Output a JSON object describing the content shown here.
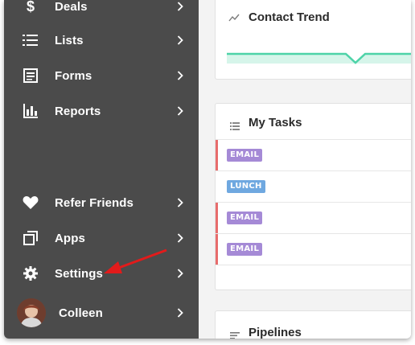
{
  "sidebar": {
    "items": [
      {
        "label": "Deals",
        "icon": "dollar-icon"
      },
      {
        "label": "Lists",
        "icon": "list-icon"
      },
      {
        "label": "Forms",
        "icon": "form-icon"
      },
      {
        "label": "Reports",
        "icon": "bar-chart-icon"
      },
      {
        "label": "Refer Friends",
        "icon": "heart-icon"
      },
      {
        "label": "Apps",
        "icon": "apps-icon"
      },
      {
        "label": "Settings",
        "icon": "gear-icon"
      }
    ],
    "user": {
      "name": "Colleen"
    }
  },
  "main": {
    "contact_trend": {
      "title": "Contact Trend"
    },
    "my_tasks": {
      "title": "My Tasks",
      "tasks": [
        {
          "type": "EMAIL",
          "color": "#a58ad6"
        },
        {
          "type": "LUNCH",
          "color": "#6fa8e0"
        },
        {
          "type": "EMAIL",
          "color": "#a58ad6"
        },
        {
          "type": "EMAIL",
          "color": "#a58ad6"
        }
      ]
    },
    "pipelines": {
      "title": "Pipelines"
    }
  },
  "colors": {
    "sidebar_bg": "#4b4b4b",
    "trend_line": "#4dd3a8",
    "task_overdue_bar": "#e86c6c",
    "annotation_arrow": "#e21b1b"
  }
}
